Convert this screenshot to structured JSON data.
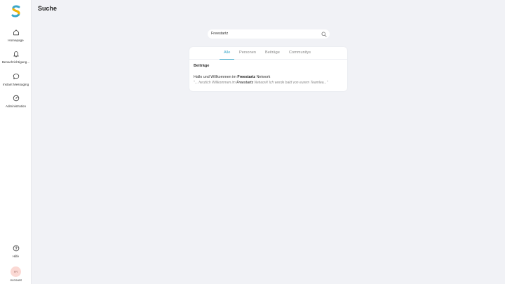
{
  "page": {
    "title": "Suche"
  },
  "sidebar": {
    "items": [
      {
        "label": "Homepage",
        "icon": "home-icon"
      },
      {
        "label": "Benachrichtigung...",
        "icon": "bell-icon"
      },
      {
        "label": "Instant Messaging",
        "icon": "chat-icon"
      },
      {
        "label": "Administration",
        "icon": "gauge-icon"
      }
    ],
    "help": {
      "label": "Hilfe",
      "icon": "question-circle-icon"
    },
    "account": {
      "label": "Account",
      "initials": "FR"
    }
  },
  "search": {
    "value": "Freestartz",
    "icon": "search-icon"
  },
  "tabs": [
    {
      "label": "Alle",
      "active": true
    },
    {
      "label": "Personen",
      "active": false
    },
    {
      "label": "Beiträge",
      "active": false
    },
    {
      "label": "Communitys",
      "active": false
    }
  ],
  "results": {
    "section_title": "Beiträge",
    "items": [
      {
        "title_prefix": "Hallo und Willkommen im ",
        "title_highlight": "Freestartz",
        "title_suffix": " Network",
        "snippet_prefix": "\"... herzlich Willkommen im ",
        "snippet_highlight": "Freestartz",
        "snippet_suffix": " Network! Ich werde bald von eurem Teamlea...\""
      }
    ]
  },
  "colors": {
    "accent": "#3aa7c9",
    "background": "#f1f2f6",
    "avatar_bg": "#fbd9d4"
  }
}
